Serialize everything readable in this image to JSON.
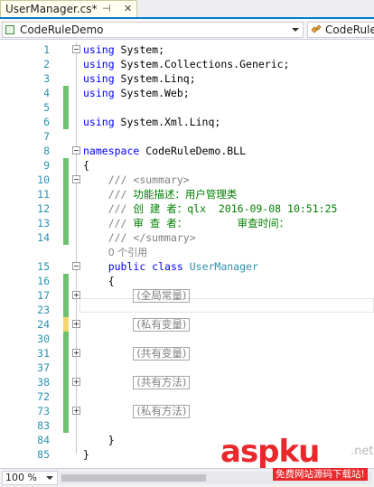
{
  "tab": {
    "title": "UserManager.cs*",
    "pin_glyph": "⊣",
    "close_glyph": "✕"
  },
  "navbar": {
    "project": "CodeRuleDemo",
    "member": "CodeRule"
  },
  "editor": {
    "lines": [
      {
        "n": "1",
        "text": "using System;"
      },
      {
        "n": "2",
        "text": "using System.Collections.Generic;"
      },
      {
        "n": "3",
        "text": "using System.Linq;"
      },
      {
        "n": "4",
        "text": "using System.Web;"
      },
      {
        "n": "5",
        "text": ""
      },
      {
        "n": "6",
        "text": "using System.Xml.Linq;"
      },
      {
        "n": "7",
        "text": ""
      },
      {
        "n": "8",
        "text": "CodeRuleDemo.BLL",
        "kw": "namespace "
      },
      {
        "n": "9",
        "text": "{"
      },
      {
        "n": "10",
        "text": "<summary>",
        "prefix": "/// "
      },
      {
        "n": "11",
        "text": "功能描述：用户管理类",
        "prefix": "/// "
      },
      {
        "n": "12",
        "text": "创 建 者：qlx  2016-09-08 10:51:25",
        "prefix": "/// "
      },
      {
        "n": "13",
        "text": "审 查 者：        审查时间：",
        "prefix": "/// "
      },
      {
        "n": "14",
        "text": "</summary>",
        "prefix": "/// "
      },
      {
        "n": "",
        "text": "0 个引用"
      },
      {
        "n": "15",
        "text": "UserManager",
        "kw": "public class "
      },
      {
        "n": "16",
        "text": "{"
      },
      {
        "n": "17",
        "text": "全局常量"
      },
      {
        "n": "23",
        "text": ""
      },
      {
        "n": "24",
        "text": "私有变量"
      },
      {
        "n": "30",
        "text": ""
      },
      {
        "n": "31",
        "text": "共有变量"
      },
      {
        "n": "37",
        "text": ""
      },
      {
        "n": "38",
        "text": "共有方法"
      },
      {
        "n": "72",
        "text": ""
      },
      {
        "n": "73",
        "text": "私有方法"
      },
      {
        "n": "83",
        "text": ""
      },
      {
        "n": "84",
        "text": "}"
      },
      {
        "n": "85",
        "text": "}"
      }
    ]
  },
  "status": {
    "zoom": "100 %"
  },
  "watermark": {
    "logo": "aspku",
    "suffix": ".net",
    "subtitle": "免费网站源码下载站!"
  },
  "colors": {
    "accent": "#007acc",
    "keyword": "#0000ff",
    "type": "#2b91af",
    "comment": "#008000",
    "line_number": "#2b91af",
    "change_saved": "#6fc06f",
    "change_unsaved": "#f2d86b"
  }
}
